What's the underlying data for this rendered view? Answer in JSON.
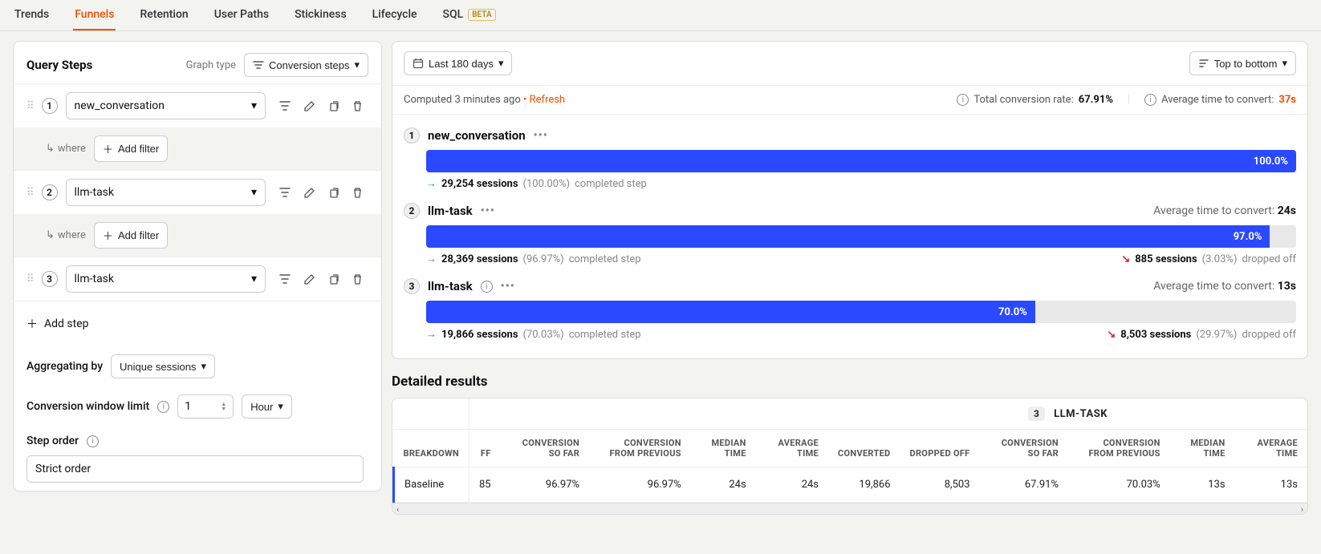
{
  "tabs": {
    "items": [
      "Trends",
      "Funnels",
      "Retention",
      "User Paths",
      "Stickiness",
      "Lifecycle",
      "SQL"
    ],
    "active": "Funnels",
    "beta_label": "BETA"
  },
  "query": {
    "title": "Query Steps",
    "graph_type_label": "Graph type",
    "graph_type_value": "Conversion steps",
    "steps": [
      {
        "num": "1",
        "event": "new_conversation"
      },
      {
        "num": "2",
        "event": "llm-task"
      },
      {
        "num": "3",
        "event": "llm-task"
      }
    ],
    "where_label": "where",
    "add_filter_label": "Add filter",
    "add_step_label": "Add step",
    "aggregating_label": "Aggregating by",
    "aggregating_value": "Unique sessions",
    "window_label": "Conversion window limit",
    "window_value": "1",
    "window_unit": "Hour",
    "step_order_label": "Step order",
    "strict_order": "Strict order"
  },
  "topbar": {
    "date_range": "Last 180 days",
    "top_bottom": "Top to bottom"
  },
  "computed": {
    "text": "Computed 3 minutes ago",
    "refresh": "Refresh",
    "total_conv_label": "Total conversion rate:",
    "total_conv_value": "67.91%",
    "avg_time_label": "Average time to convert:",
    "avg_time_value": "37s"
  },
  "funnel": [
    {
      "num": "1",
      "name": "new_conversation",
      "pct": "100.0%",
      "bar_width": "100%",
      "comp_sessions": "29,254 sessions",
      "comp_pct": "(100.00%)",
      "comp_suffix": "completed step",
      "avg_label": "",
      "avg_val": "",
      "drop_sessions": "",
      "drop_pct": "",
      "drop_suffix": ""
    },
    {
      "num": "2",
      "name": "llm-task",
      "pct": "97.0%",
      "bar_width": "97%",
      "comp_sessions": "28,369 sessions",
      "comp_pct": "(96.97%)",
      "comp_suffix": "completed step",
      "avg_label": "Average time to convert:",
      "avg_val": "24s",
      "drop_sessions": "885 sessions",
      "drop_pct": "(3.03%)",
      "drop_suffix": "dropped off"
    },
    {
      "num": "3",
      "name": "llm-task",
      "pct": "70.0%",
      "bar_width": "70%",
      "comp_sessions": "19,866 sessions",
      "comp_pct": "(70.03%)",
      "comp_suffix": "completed step",
      "avg_label": "Average time to convert:",
      "avg_val": "13s",
      "drop_sessions": "8,503 sessions",
      "drop_pct": "(29.97%)",
      "drop_suffix": "dropped off",
      "info": true
    }
  ],
  "detailed_title": "Detailed results",
  "table": {
    "group_num": "3",
    "group_name": "LLM-TASK",
    "headers": {
      "breakdown": "BREAKDOWN",
      "ff": "FF",
      "conv_so_far": "CONVERSION SO FAR",
      "conv_prev": "CONVERSION FROM PREVIOUS",
      "med_time": "MEDIAN TIME",
      "avg_time": "AVERAGE TIME",
      "converted": "CONVERTED",
      "dropped": "DROPPED OFF",
      "conv_so_far2": "CONVERSION SO FAR",
      "conv_prev2": "CONVERSION FROM PREVIOUS",
      "med_time2": "MEDIAN TIME",
      "avg_time2": "AVERAGE TIME"
    },
    "row": {
      "breakdown": "Baseline",
      "ff": "85",
      "conv_so_far": "96.97%",
      "conv_prev": "96.97%",
      "med_time": "24s",
      "avg_time": "24s",
      "converted": "19,866",
      "dropped": "8,503",
      "conv_so_far2": "67.91%",
      "conv_prev2": "70.03%",
      "med_time2": "13s",
      "avg_time2": "13s"
    }
  }
}
